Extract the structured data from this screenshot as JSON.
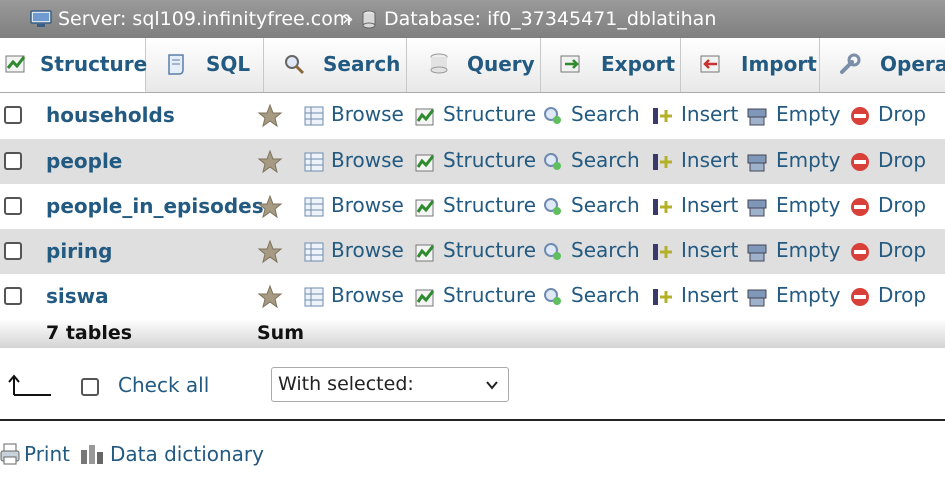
{
  "breadcrumb": {
    "server_label": "Server: sql109.infinityfree.com",
    "separator": "»",
    "database_label": "Database: if0_37345471_dblatihan"
  },
  "tabs": [
    {
      "label": "Structure",
      "icon": "structure-icon",
      "active": true
    },
    {
      "label": "SQL",
      "icon": "sql-icon",
      "active": false
    },
    {
      "label": "Search",
      "icon": "search-icon",
      "active": false
    },
    {
      "label": "Query",
      "icon": "query-icon",
      "active": false
    },
    {
      "label": "Export",
      "icon": "export-icon",
      "active": false
    },
    {
      "label": "Import",
      "icon": "import-icon",
      "active": false
    },
    {
      "label": "Operat",
      "icon": "operations-icon",
      "active": false
    }
  ],
  "tables": [
    {
      "name": "households"
    },
    {
      "name": "people"
    },
    {
      "name": "people_in_episodes"
    },
    {
      "name": "piring"
    },
    {
      "name": "siswa"
    }
  ],
  "row_actions": {
    "browse": "Browse",
    "structure": "Structure",
    "search": "Search",
    "insert": "Insert",
    "empty": "Empty",
    "drop": "Drop"
  },
  "summary": {
    "count_label": "7 tables",
    "sum_label": "Sum"
  },
  "bulk": {
    "check_all_label": "Check all",
    "with_selected_label": "With selected:"
  },
  "footer_links": {
    "print_label": "Print",
    "data_dictionary_label": "Data dictionary"
  },
  "colors": {
    "link": "#235a81",
    "topbar": "#8c8c8c",
    "row_alt": "#dfdfdf",
    "drop_red": "#d9403a"
  }
}
